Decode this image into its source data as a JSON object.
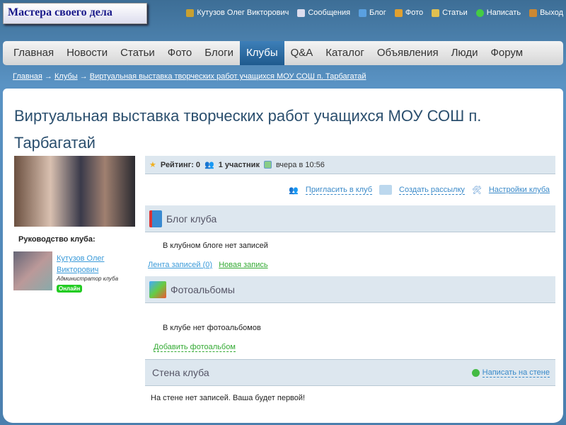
{
  "logo": "Мастера своего дела",
  "top_links": [
    {
      "label": "Кутузов Олег Викторович",
      "color": "#c9a030"
    },
    {
      "label": "Сообщения",
      "color": "#dde"
    },
    {
      "label": "Блог",
      "color": "#5aa0e0"
    },
    {
      "label": "Фото",
      "color": "#e0a030"
    },
    {
      "label": "Статьи",
      "color": "#e0c050"
    },
    {
      "label": "Написать",
      "color": "#4c4"
    },
    {
      "label": "Выход",
      "color": "#c83"
    }
  ],
  "nav": [
    "Главная",
    "Новости",
    "Статьи",
    "Фото",
    "Блоги",
    "Клубы",
    "Q&A",
    "Каталог",
    "Объявления",
    "Люди",
    "Форум"
  ],
  "breadcrumb": [
    "Главная",
    "Клубы",
    "Виртуальная выставка творческих работ учащихся МОУ СОШ п. Тарбагатай"
  ],
  "title": "Виртуальная выставка творческих работ учащихся МОУ СОШ п. Тарбагатай",
  "leadership": {
    "label": "Руководство клуба:",
    "name": "Кутузов Олег Викторович",
    "role": "Администратор клуба",
    "status": "Онлайн"
  },
  "info": {
    "rating": "Рейтинг: 0",
    "members": "1 участник",
    "date": "вчера в 10:56"
  },
  "actions": [
    "Пригласить в клуб",
    "Создать рассылку",
    "Настройки клуба"
  ],
  "blog": {
    "title": "Блог клуба",
    "empty": "В клубном блоге нет записей",
    "feed": "Лента записей (0)",
    "new": "Новая запись"
  },
  "albums": {
    "title": "Фотоальбомы",
    "empty": "В клубе нет фотоальбомов",
    "add": "Добавить фотоальбом"
  },
  "wall": {
    "title": "Стена клуба",
    "write": "Написать на стене",
    "empty": "На стене нет записей. Ваша будет первой!"
  }
}
